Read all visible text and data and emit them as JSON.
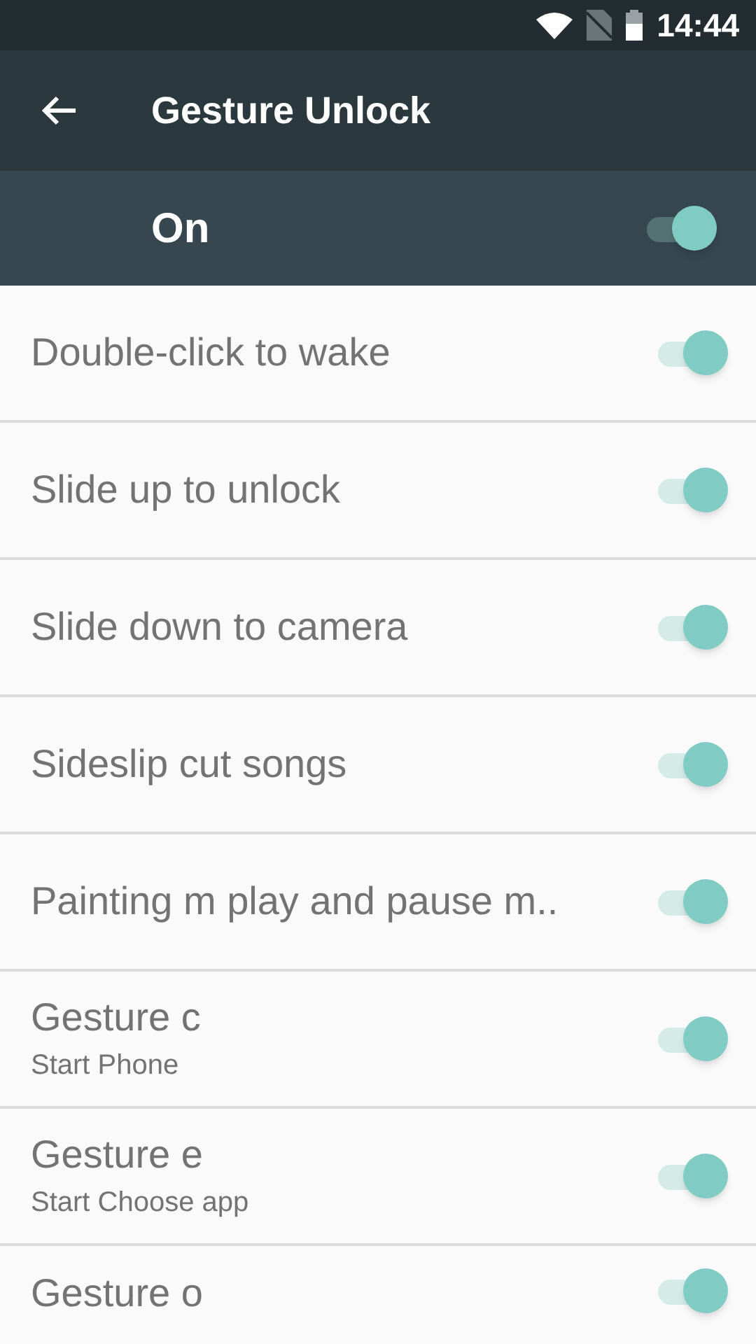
{
  "status_bar": {
    "time": "14:44"
  },
  "toolbar": {
    "title": "Gesture Unlock"
  },
  "master": {
    "label": "On",
    "on": true
  },
  "settings": [
    {
      "title": "Double-click to wake",
      "on": true
    },
    {
      "title": "Slide up to unlock",
      "on": true
    },
    {
      "title": "Slide down to camera",
      "on": true
    },
    {
      "title": "Sideslip cut songs",
      "on": true
    },
    {
      "title": "Painting m play and pause m..",
      "on": true
    },
    {
      "title": "Gesture c",
      "subtitle": "Start Phone",
      "on": true
    },
    {
      "title": "Gesture e",
      "subtitle": "Start Choose app",
      "on": true
    },
    {
      "title": "Gesture o",
      "on": true
    }
  ]
}
